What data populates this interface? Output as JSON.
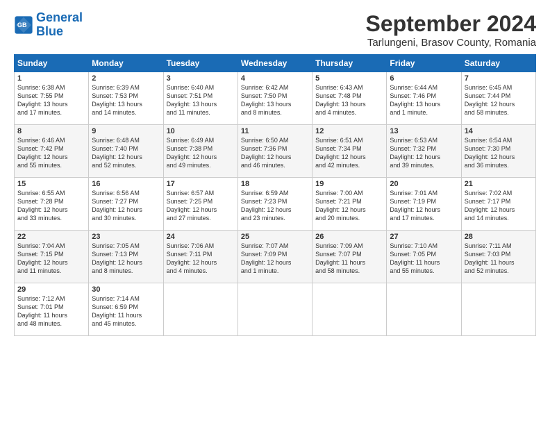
{
  "header": {
    "logo_line1": "General",
    "logo_line2": "Blue",
    "month": "September 2024",
    "location": "Tarlungeni, Brasov County, Romania"
  },
  "weekdays": [
    "Sunday",
    "Monday",
    "Tuesday",
    "Wednesday",
    "Thursday",
    "Friday",
    "Saturday"
  ],
  "weeks": [
    [
      {
        "day": "1",
        "lines": [
          "Sunrise: 6:38 AM",
          "Sunset: 7:55 PM",
          "Daylight: 13 hours",
          "and 17 minutes."
        ]
      },
      {
        "day": "2",
        "lines": [
          "Sunrise: 6:39 AM",
          "Sunset: 7:53 PM",
          "Daylight: 13 hours",
          "and 14 minutes."
        ]
      },
      {
        "day": "3",
        "lines": [
          "Sunrise: 6:40 AM",
          "Sunset: 7:51 PM",
          "Daylight: 13 hours",
          "and 11 minutes."
        ]
      },
      {
        "day": "4",
        "lines": [
          "Sunrise: 6:42 AM",
          "Sunset: 7:50 PM",
          "Daylight: 13 hours",
          "and 8 minutes."
        ]
      },
      {
        "day": "5",
        "lines": [
          "Sunrise: 6:43 AM",
          "Sunset: 7:48 PM",
          "Daylight: 13 hours",
          "and 4 minutes."
        ]
      },
      {
        "day": "6",
        "lines": [
          "Sunrise: 6:44 AM",
          "Sunset: 7:46 PM",
          "Daylight: 13 hours",
          "and 1 minute."
        ]
      },
      {
        "day": "7",
        "lines": [
          "Sunrise: 6:45 AM",
          "Sunset: 7:44 PM",
          "Daylight: 12 hours",
          "and 58 minutes."
        ]
      }
    ],
    [
      {
        "day": "8",
        "lines": [
          "Sunrise: 6:46 AM",
          "Sunset: 7:42 PM",
          "Daylight: 12 hours",
          "and 55 minutes."
        ]
      },
      {
        "day": "9",
        "lines": [
          "Sunrise: 6:48 AM",
          "Sunset: 7:40 PM",
          "Daylight: 12 hours",
          "and 52 minutes."
        ]
      },
      {
        "day": "10",
        "lines": [
          "Sunrise: 6:49 AM",
          "Sunset: 7:38 PM",
          "Daylight: 12 hours",
          "and 49 minutes."
        ]
      },
      {
        "day": "11",
        "lines": [
          "Sunrise: 6:50 AM",
          "Sunset: 7:36 PM",
          "Daylight: 12 hours",
          "and 46 minutes."
        ]
      },
      {
        "day": "12",
        "lines": [
          "Sunrise: 6:51 AM",
          "Sunset: 7:34 PM",
          "Daylight: 12 hours",
          "and 42 minutes."
        ]
      },
      {
        "day": "13",
        "lines": [
          "Sunrise: 6:53 AM",
          "Sunset: 7:32 PM",
          "Daylight: 12 hours",
          "and 39 minutes."
        ]
      },
      {
        "day": "14",
        "lines": [
          "Sunrise: 6:54 AM",
          "Sunset: 7:30 PM",
          "Daylight: 12 hours",
          "and 36 minutes."
        ]
      }
    ],
    [
      {
        "day": "15",
        "lines": [
          "Sunrise: 6:55 AM",
          "Sunset: 7:28 PM",
          "Daylight: 12 hours",
          "and 33 minutes."
        ]
      },
      {
        "day": "16",
        "lines": [
          "Sunrise: 6:56 AM",
          "Sunset: 7:27 PM",
          "Daylight: 12 hours",
          "and 30 minutes."
        ]
      },
      {
        "day": "17",
        "lines": [
          "Sunrise: 6:57 AM",
          "Sunset: 7:25 PM",
          "Daylight: 12 hours",
          "and 27 minutes."
        ]
      },
      {
        "day": "18",
        "lines": [
          "Sunrise: 6:59 AM",
          "Sunset: 7:23 PM",
          "Daylight: 12 hours",
          "and 23 minutes."
        ]
      },
      {
        "day": "19",
        "lines": [
          "Sunrise: 7:00 AM",
          "Sunset: 7:21 PM",
          "Daylight: 12 hours",
          "and 20 minutes."
        ]
      },
      {
        "day": "20",
        "lines": [
          "Sunrise: 7:01 AM",
          "Sunset: 7:19 PM",
          "Daylight: 12 hours",
          "and 17 minutes."
        ]
      },
      {
        "day": "21",
        "lines": [
          "Sunrise: 7:02 AM",
          "Sunset: 7:17 PM",
          "Daylight: 12 hours",
          "and 14 minutes."
        ]
      }
    ],
    [
      {
        "day": "22",
        "lines": [
          "Sunrise: 7:04 AM",
          "Sunset: 7:15 PM",
          "Daylight: 12 hours",
          "and 11 minutes."
        ]
      },
      {
        "day": "23",
        "lines": [
          "Sunrise: 7:05 AM",
          "Sunset: 7:13 PM",
          "Daylight: 12 hours",
          "and 8 minutes."
        ]
      },
      {
        "day": "24",
        "lines": [
          "Sunrise: 7:06 AM",
          "Sunset: 7:11 PM",
          "Daylight: 12 hours",
          "and 4 minutes."
        ]
      },
      {
        "day": "25",
        "lines": [
          "Sunrise: 7:07 AM",
          "Sunset: 7:09 PM",
          "Daylight: 12 hours",
          "and 1 minute."
        ]
      },
      {
        "day": "26",
        "lines": [
          "Sunrise: 7:09 AM",
          "Sunset: 7:07 PM",
          "Daylight: 11 hours",
          "and 58 minutes."
        ]
      },
      {
        "day": "27",
        "lines": [
          "Sunrise: 7:10 AM",
          "Sunset: 7:05 PM",
          "Daylight: 11 hours",
          "and 55 minutes."
        ]
      },
      {
        "day": "28",
        "lines": [
          "Sunrise: 7:11 AM",
          "Sunset: 7:03 PM",
          "Daylight: 11 hours",
          "and 52 minutes."
        ]
      }
    ],
    [
      {
        "day": "29",
        "lines": [
          "Sunrise: 7:12 AM",
          "Sunset: 7:01 PM",
          "Daylight: 11 hours",
          "and 48 minutes."
        ]
      },
      {
        "day": "30",
        "lines": [
          "Sunrise: 7:14 AM",
          "Sunset: 6:59 PM",
          "Daylight: 11 hours",
          "and 45 minutes."
        ]
      },
      null,
      null,
      null,
      null,
      null
    ]
  ]
}
